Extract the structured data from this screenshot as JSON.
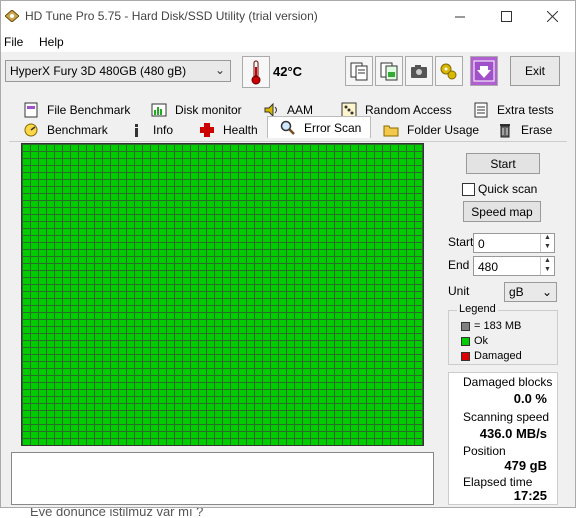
{
  "window": {
    "title": "HD Tune Pro 5.75 - Hard Disk/SSD Utility (trial version)"
  },
  "menu": {
    "file": "File",
    "help": "Help"
  },
  "toolbar": {
    "drive": "HyperX Fury 3D 480GB (480 gB)",
    "temperature": "42°C",
    "exit_label": "Exit"
  },
  "tabs": {
    "row1": [
      "File Benchmark",
      "Disk monitor",
      "AAM",
      "Random Access",
      "Extra tests"
    ],
    "row2": [
      "Benchmark",
      "Info",
      "Health",
      "Error Scan",
      "Folder Usage",
      "Erase"
    ],
    "active": "Error Scan"
  },
  "controls": {
    "start_label": "Start",
    "quick_scan_label": "Quick scan",
    "quick_scan_checked": false,
    "speed_map_label": "Speed map",
    "start_field_label": "Start",
    "start_value": "0",
    "end_field_label": "End",
    "end_value": "480",
    "unit_label": "Unit",
    "unit_value": "gB"
  },
  "legend": {
    "title": "Legend",
    "items": [
      {
        "label": "= 183 MB",
        "color": "#808080"
      },
      {
        "label": "Ok",
        "color": "#00cc00"
      },
      {
        "label": "Damaged",
        "color": "#dd0000"
      }
    ]
  },
  "stats": {
    "damaged_blocks_label": "Damaged blocks",
    "damaged_blocks_value": "0.0 %",
    "scanning_speed_label": "Scanning speed",
    "scanning_speed_value": "436.0 MB/s",
    "position_label": "Position",
    "position_value": "479 gB",
    "elapsed_label": "Elapsed time",
    "elapsed_value": "17:25"
  },
  "colors": {
    "ok_block": "#00cc00",
    "grid_line": "#2a6a2a"
  },
  "background_text": "Eve dönünce istilmuz var mı ?"
}
